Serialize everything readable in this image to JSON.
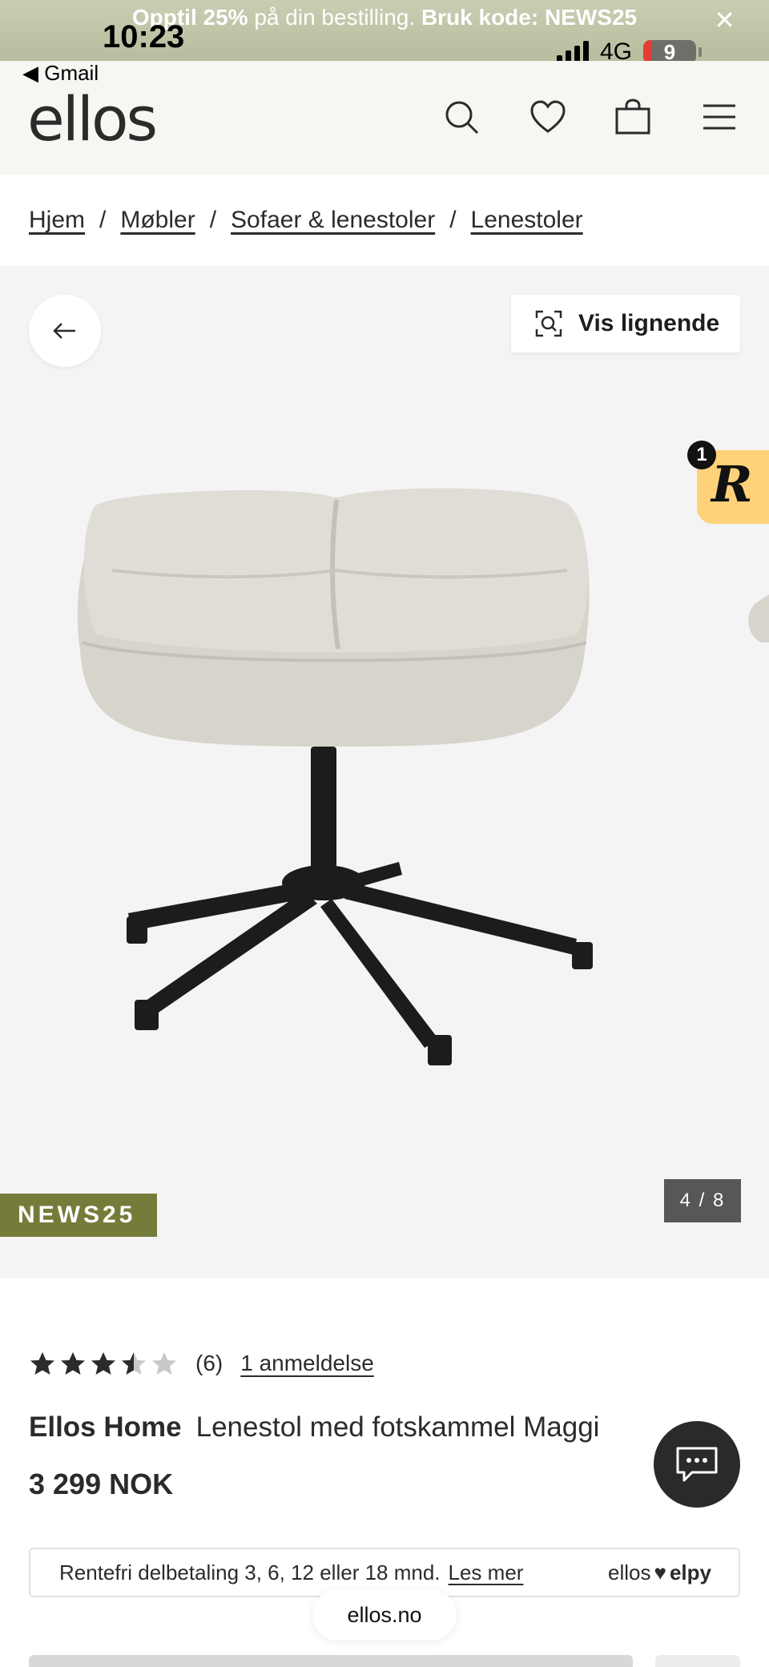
{
  "status_bar": {
    "time": "10:23",
    "network": "4G",
    "battery": "9",
    "back_app": "◀ Gmail"
  },
  "promo": {
    "bold_prefix": "Opptil 25%",
    "text": " på din bestilling. ",
    "code_text": "Bruk kode: NEWS25",
    "close_icon": "close-icon"
  },
  "header": {
    "logo": "ellos",
    "icons": [
      "search-icon",
      "heart-icon",
      "bag-icon",
      "menu-icon"
    ]
  },
  "breadcrumb": {
    "items": [
      "Hjem",
      "Møbler",
      "Sofaer & lenestoler",
      "Lenestoler"
    ],
    "separator": "/"
  },
  "gallery": {
    "similar_label": "Vis lignende",
    "promo_code": "NEWS25",
    "counter": "4 / 8",
    "reward_badge": "1",
    "reward_glyph": "R"
  },
  "product": {
    "rating_value": 3.5,
    "rating_max": 5,
    "review_count": "(6)",
    "reviews_link": "1 anmeldelse",
    "brand": "Ellos Home",
    "name": "Lenestol med fotskammel Maggi",
    "price": "3 299 NOK"
  },
  "finance": {
    "text": "Rentefri delbetaling 3, 6, 12 eller 18 mnd.",
    "link": "Les mer",
    "logo_left": "ellos",
    "logo_right": "elpy"
  },
  "browser": {
    "url": "ellos.no"
  },
  "colors": {
    "promo_bg": "#c9cdb2",
    "header_bg": "#f7f6f3",
    "gallery_bg": "#f4f4f4",
    "promo_badge": "#757c3a",
    "reward": "#ffd27a"
  }
}
